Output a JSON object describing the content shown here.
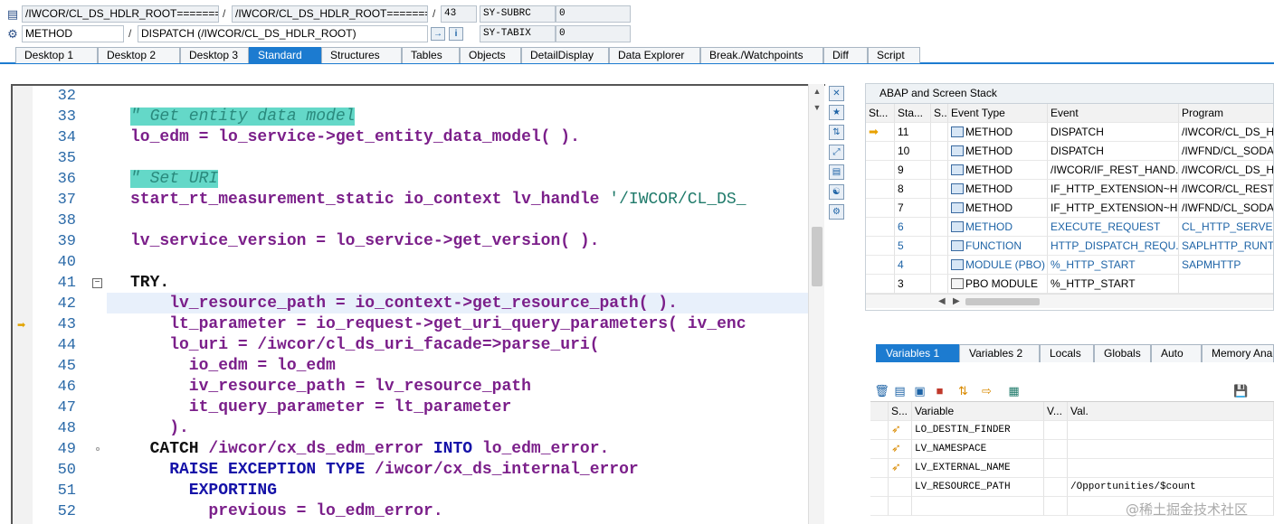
{
  "header": {
    "row1": {
      "program_main": "/IWCOR/CL_DS_HDLR_ROOT=======…",
      "program_include": "/IWCOR/CL_DS_HDLR_ROOT=======…",
      "line": "43",
      "sysvar_label": "SY-SUBRC",
      "sysvar_value": "0"
    },
    "row2": {
      "event_type": "METHOD",
      "event_name": "DISPATCH (/IWCOR/CL_DS_HDLR_ROOT)",
      "sysvar_label": "SY-TABIX",
      "sysvar_value": "0"
    }
  },
  "tabs": [
    {
      "label": "Desktop 1"
    },
    {
      "label": "Desktop 2"
    },
    {
      "label": "Desktop 3"
    },
    {
      "label": "Standard"
    },
    {
      "label": "Structures"
    },
    {
      "label": "Tables"
    },
    {
      "label": "Objects"
    },
    {
      "label": "DetailDisplay"
    },
    {
      "label": "Data Explorer"
    },
    {
      "label": "Break./Watchpoints"
    },
    {
      "label": "Diff"
    },
    {
      "label": "Script"
    }
  ],
  "active_tab": "Standard",
  "editor": {
    "current_line": "42",
    "debug_line": "43",
    "lines": [
      {
        "no": "32"
      },
      {
        "no": "33",
        "comment": "\" Get entity data model"
      },
      {
        "no": "34",
        "text": "lo_edm = lo_service->get_entity_data_model( )."
      },
      {
        "no": "35"
      },
      {
        "no": "36",
        "comment": "\" Set URI"
      },
      {
        "no": "37",
        "pre": "start_rt_measurement_static io_context lv_handle ",
        "str": "'/IWCOR/CL_DS_"
      },
      {
        "no": "38"
      },
      {
        "no": "39",
        "text": "lv_service_version = lo_service->get_version( )."
      },
      {
        "no": "40"
      },
      {
        "no": "41",
        "kwb": "TRY."
      },
      {
        "no": "42",
        "text": "    lv_resource_path = io_context->get_resource_path( )."
      },
      {
        "no": "43",
        "text": "    lt_parameter = io_request->get_uri_query_parameters( iv_enc"
      },
      {
        "no": "44",
        "text": "    lo_uri = /iwcor/cl_ds_uri_facade=>parse_uri("
      },
      {
        "no": "45",
        "text": "      io_edm = lo_edm"
      },
      {
        "no": "46",
        "text": "      iv_resource_path = lv_resource_path"
      },
      {
        "no": "47",
        "text": "      it_query_parameter = lt_parameter"
      },
      {
        "no": "48",
        "text": "    )."
      },
      {
        "no": "49",
        "kwb": "  CATCH",
        "rest": " /iwcor/cx_ds_edm_error ",
        "kw2": "INTO",
        "rest2": " lo_edm_error."
      },
      {
        "no": "50",
        "kw": "    RAISE EXCEPTION TYPE",
        "rest": " /iwcor/cx_ds_internal_error"
      },
      {
        "no": "51",
        "kw": "      EXPORTING"
      },
      {
        "no": "52",
        "text": "        previous = lo_edm_error."
      }
    ]
  },
  "stack": {
    "title": "ABAP and Screen Stack",
    "columns": [
      "St...",
      "Sta...",
      "S...",
      "Event Type",
      "Event",
      "Program"
    ],
    "rows": [
      {
        "level": "11",
        "type": "METHOD",
        "event": "DISPATCH",
        "program": "/IWCOR/CL_DS_HD",
        "current": true
      },
      {
        "level": "10",
        "type": "METHOD",
        "event": "DISPATCH",
        "program": "/IWFND/CL_SODAT"
      },
      {
        "level": "9",
        "type": "METHOD",
        "event": "/IWCOR/IF_REST_HAND...",
        "program": "/IWCOR/CL_DS_HD"
      },
      {
        "level": "8",
        "type": "METHOD",
        "event": "IF_HTTP_EXTENSION~H...",
        "program": "/IWCOR/CL_REST_"
      },
      {
        "level": "7",
        "type": "METHOD",
        "event": "IF_HTTP_EXTENSION~H...",
        "program": "/IWFND/CL_SODAT"
      },
      {
        "level": "6",
        "type": "METHOD",
        "event": "EXECUTE_REQUEST",
        "program": "CL_HTTP_SERVER=",
        "stale": true
      },
      {
        "level": "5",
        "type": "FUNCTION",
        "event": "HTTP_DISPATCH_REQU...",
        "program": "SAPLHTTP_RUNTIM",
        "stale": true
      },
      {
        "level": "4",
        "type": "MODULE (PBO)",
        "event": "%_HTTP_START",
        "program": "SAPMHTTP",
        "stale": true
      },
      {
        "level": "3",
        "type": "PBO MODULE",
        "event": "%_HTTP_START",
        "program": ""
      }
    ]
  },
  "var_tabs": [
    {
      "label": "Variables 1"
    },
    {
      "label": "Variables 2"
    },
    {
      "label": "Locals"
    },
    {
      "label": "Globals"
    },
    {
      "label": "Auto"
    },
    {
      "label": "Memory Ana"
    }
  ],
  "variables": {
    "columns": [
      "S...",
      "Variable",
      "V...",
      "Val."
    ],
    "rows": [
      {
        "name": "LO_DESTIN_FINDER",
        "value": "",
        "icon": true
      },
      {
        "name": "LV_NAMESPACE",
        "value": "",
        "icon": true
      },
      {
        "name": "LV_EXTERNAL_NAME",
        "value": "",
        "icon": true
      },
      {
        "name": "LV_RESOURCE_PATH",
        "value": "/Opportunities/$count",
        "icon": false
      },
      {
        "name": "",
        "value": "",
        "icon": false
      },
      {
        "name": "",
        "value": "",
        "icon": false
      }
    ]
  },
  "watermark": "@稀土掘金技术社区",
  "colors": {
    "tab_active": "#1c7bd0",
    "keyword": "#1512a8",
    "identifier": "#7b1f8a",
    "comment_bg": "#64d8c8"
  }
}
